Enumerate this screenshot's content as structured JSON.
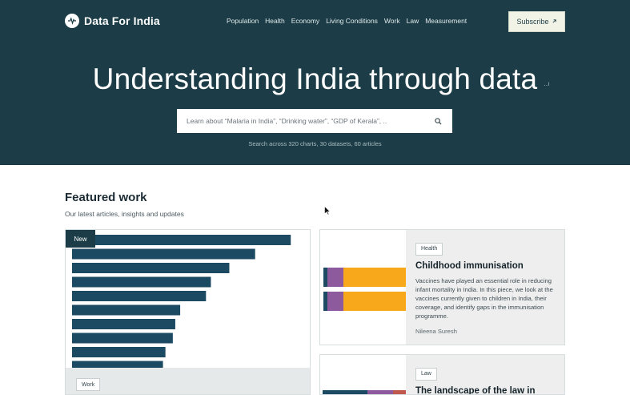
{
  "brand": {
    "name": "Data For India"
  },
  "nav": [
    "Population",
    "Health",
    "Economy",
    "Living Conditions",
    "Work",
    "Law",
    "Measurement"
  ],
  "subscribe": {
    "label": "Subscribe",
    "icon": "arrow-up-right-icon"
  },
  "hero": {
    "title": "Understanding India through data",
    "search_placeholder": "Learn about “Malaria in India”, “Drinking water”, “GDP of Kerala”, ..",
    "search_meta": "Search across 320 charts, 30 datasets, 60 articles"
  },
  "featured": {
    "title": "Featured work",
    "subtitle": "Our latest articles, insights and updates"
  },
  "big_card": {
    "badge": "New",
    "tag": "Work",
    "bars": [
      0.89,
      0.745,
      0.64,
      0.565,
      0.545,
      0.44,
      0.42,
      0.41,
      0.38,
      0.37
    ],
    "bar_color": "#1c4a63"
  },
  "cards": [
    {
      "tag": "Health",
      "title": "Childhood immunisation",
      "description": "Vaccines have played an essential role in reducing infant mortality in India. In this piece, we look at the vaccines currently given to children in India, their coverage, and identify gaps in the immunisation programme.",
      "author": "Nileena Suresh"
    },
    {
      "tag": "Law",
      "title": "The landscape of the law in India"
    }
  ],
  "colors": {
    "hero_bg": "#1c3d47",
    "navy": "#1c4a63",
    "purple": "#8e5a9e",
    "orange": "#f7a81b",
    "red": "#c0584e"
  }
}
